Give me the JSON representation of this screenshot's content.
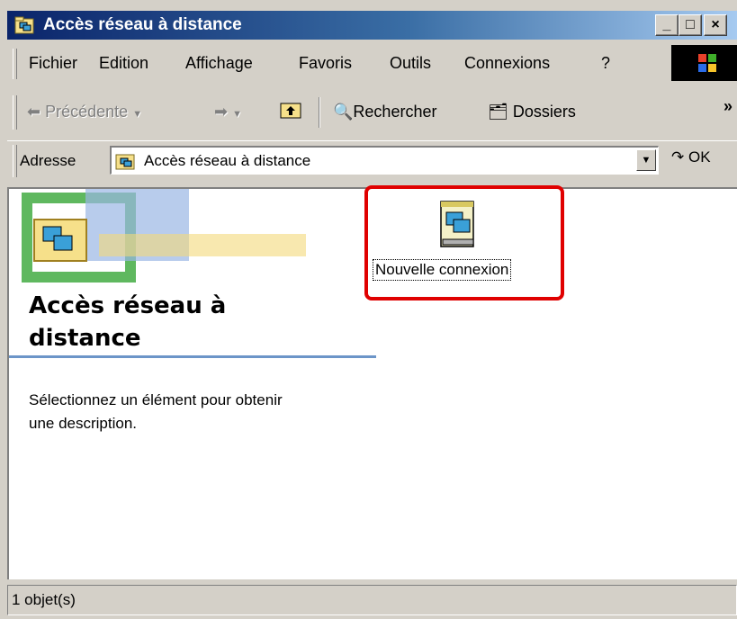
{
  "window": {
    "title": "Accès réseau à distance",
    "minimize_glyph": "_",
    "maximize_glyph": "□",
    "close_glyph": "×"
  },
  "menubar": {
    "items": [
      "Fichier",
      "Edition",
      "Affichage",
      "Favoris",
      "Outils",
      "Connexions",
      "?"
    ]
  },
  "toolbar": {
    "back_label": "Précédente",
    "search_label": "Rechercher",
    "folders_label": "Dossiers",
    "overflow_glyph": "»"
  },
  "address": {
    "label": "Adresse",
    "value": "Accès réseau à distance",
    "go_label": "OK"
  },
  "panel": {
    "title_line1": "Accès réseau à",
    "title_line2": "distance",
    "description_line1": "Sélectionnez un élément pour obtenir",
    "description_line2": "une description."
  },
  "items": [
    {
      "label": "Nouvelle connexion",
      "icon": "new-connection-icon",
      "selected": true
    }
  ],
  "status": {
    "text": "1 objet(s)"
  },
  "colors": {
    "title_start": "#0a246a",
    "title_end": "#a6caf0",
    "highlight": "#e00000",
    "face": "#d4d0c8",
    "rule": "#6c95c8"
  }
}
